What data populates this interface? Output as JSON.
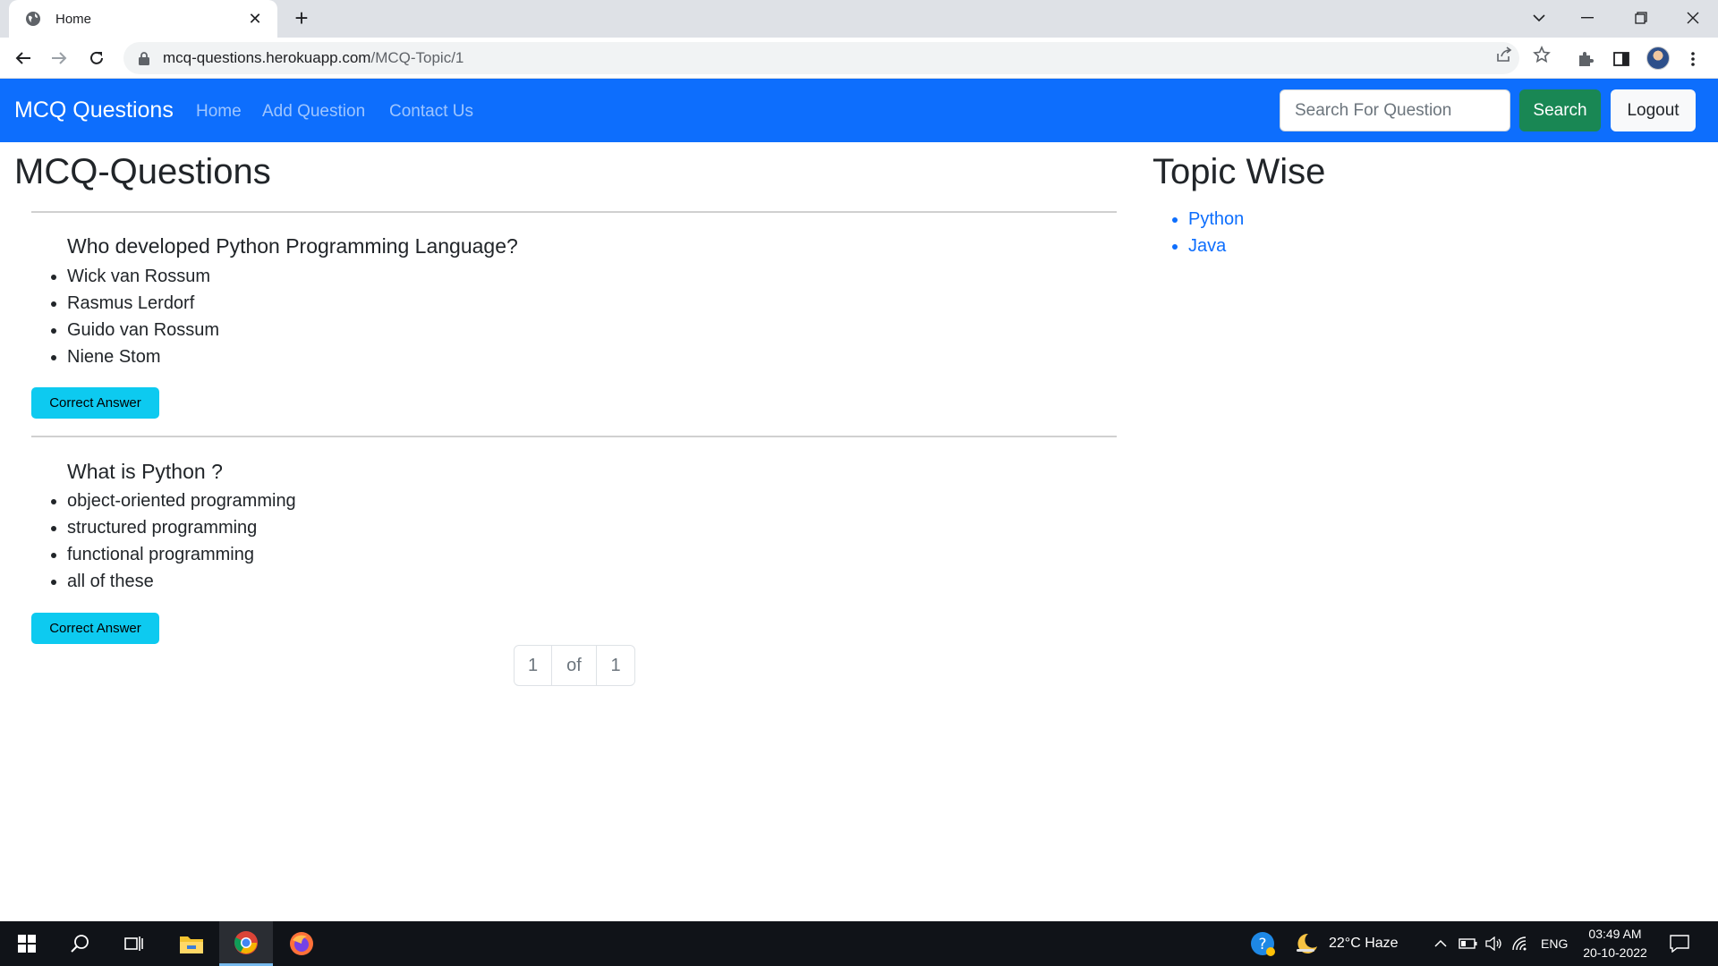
{
  "browser": {
    "tab_title": "Home",
    "url_host": "mcq-questions.herokuapp.com",
    "url_path": "/MCQ-Topic/1"
  },
  "navbar": {
    "brand": "MCQ Questions",
    "links": [
      "Home",
      "Add Question",
      "Contact Us"
    ],
    "search_placeholder": "Search For Question",
    "search_button": "Search",
    "logout_button": "Logout"
  },
  "main": {
    "title": "MCQ-Questions",
    "questions": [
      {
        "text": "Who developed Python Programming Language?",
        "options": [
          "Wick van Rossum",
          "Rasmus Lerdorf",
          "Guido van Rossum",
          "Niene Stom"
        ],
        "button": "Correct Answer"
      },
      {
        "text": "What is Python ?",
        "options": [
          "object-oriented programming",
          "structured programming",
          "functional programming",
          "all of these"
        ],
        "button": "Correct Answer"
      }
    ],
    "pagination": {
      "current": "1",
      "of": "of",
      "total": "1"
    }
  },
  "sidebar": {
    "title": "Topic Wise",
    "topics": [
      "Python",
      "Java"
    ]
  },
  "taskbar": {
    "weather": "22°C  Haze",
    "language": "ENG",
    "time": "03:49 AM",
    "date": "20-10-2022"
  },
  "colors": {
    "navbar": "#0d6efd",
    "search_button": "#198754",
    "answer_button": "#0dcaf0",
    "link": "#0d6efd"
  }
}
